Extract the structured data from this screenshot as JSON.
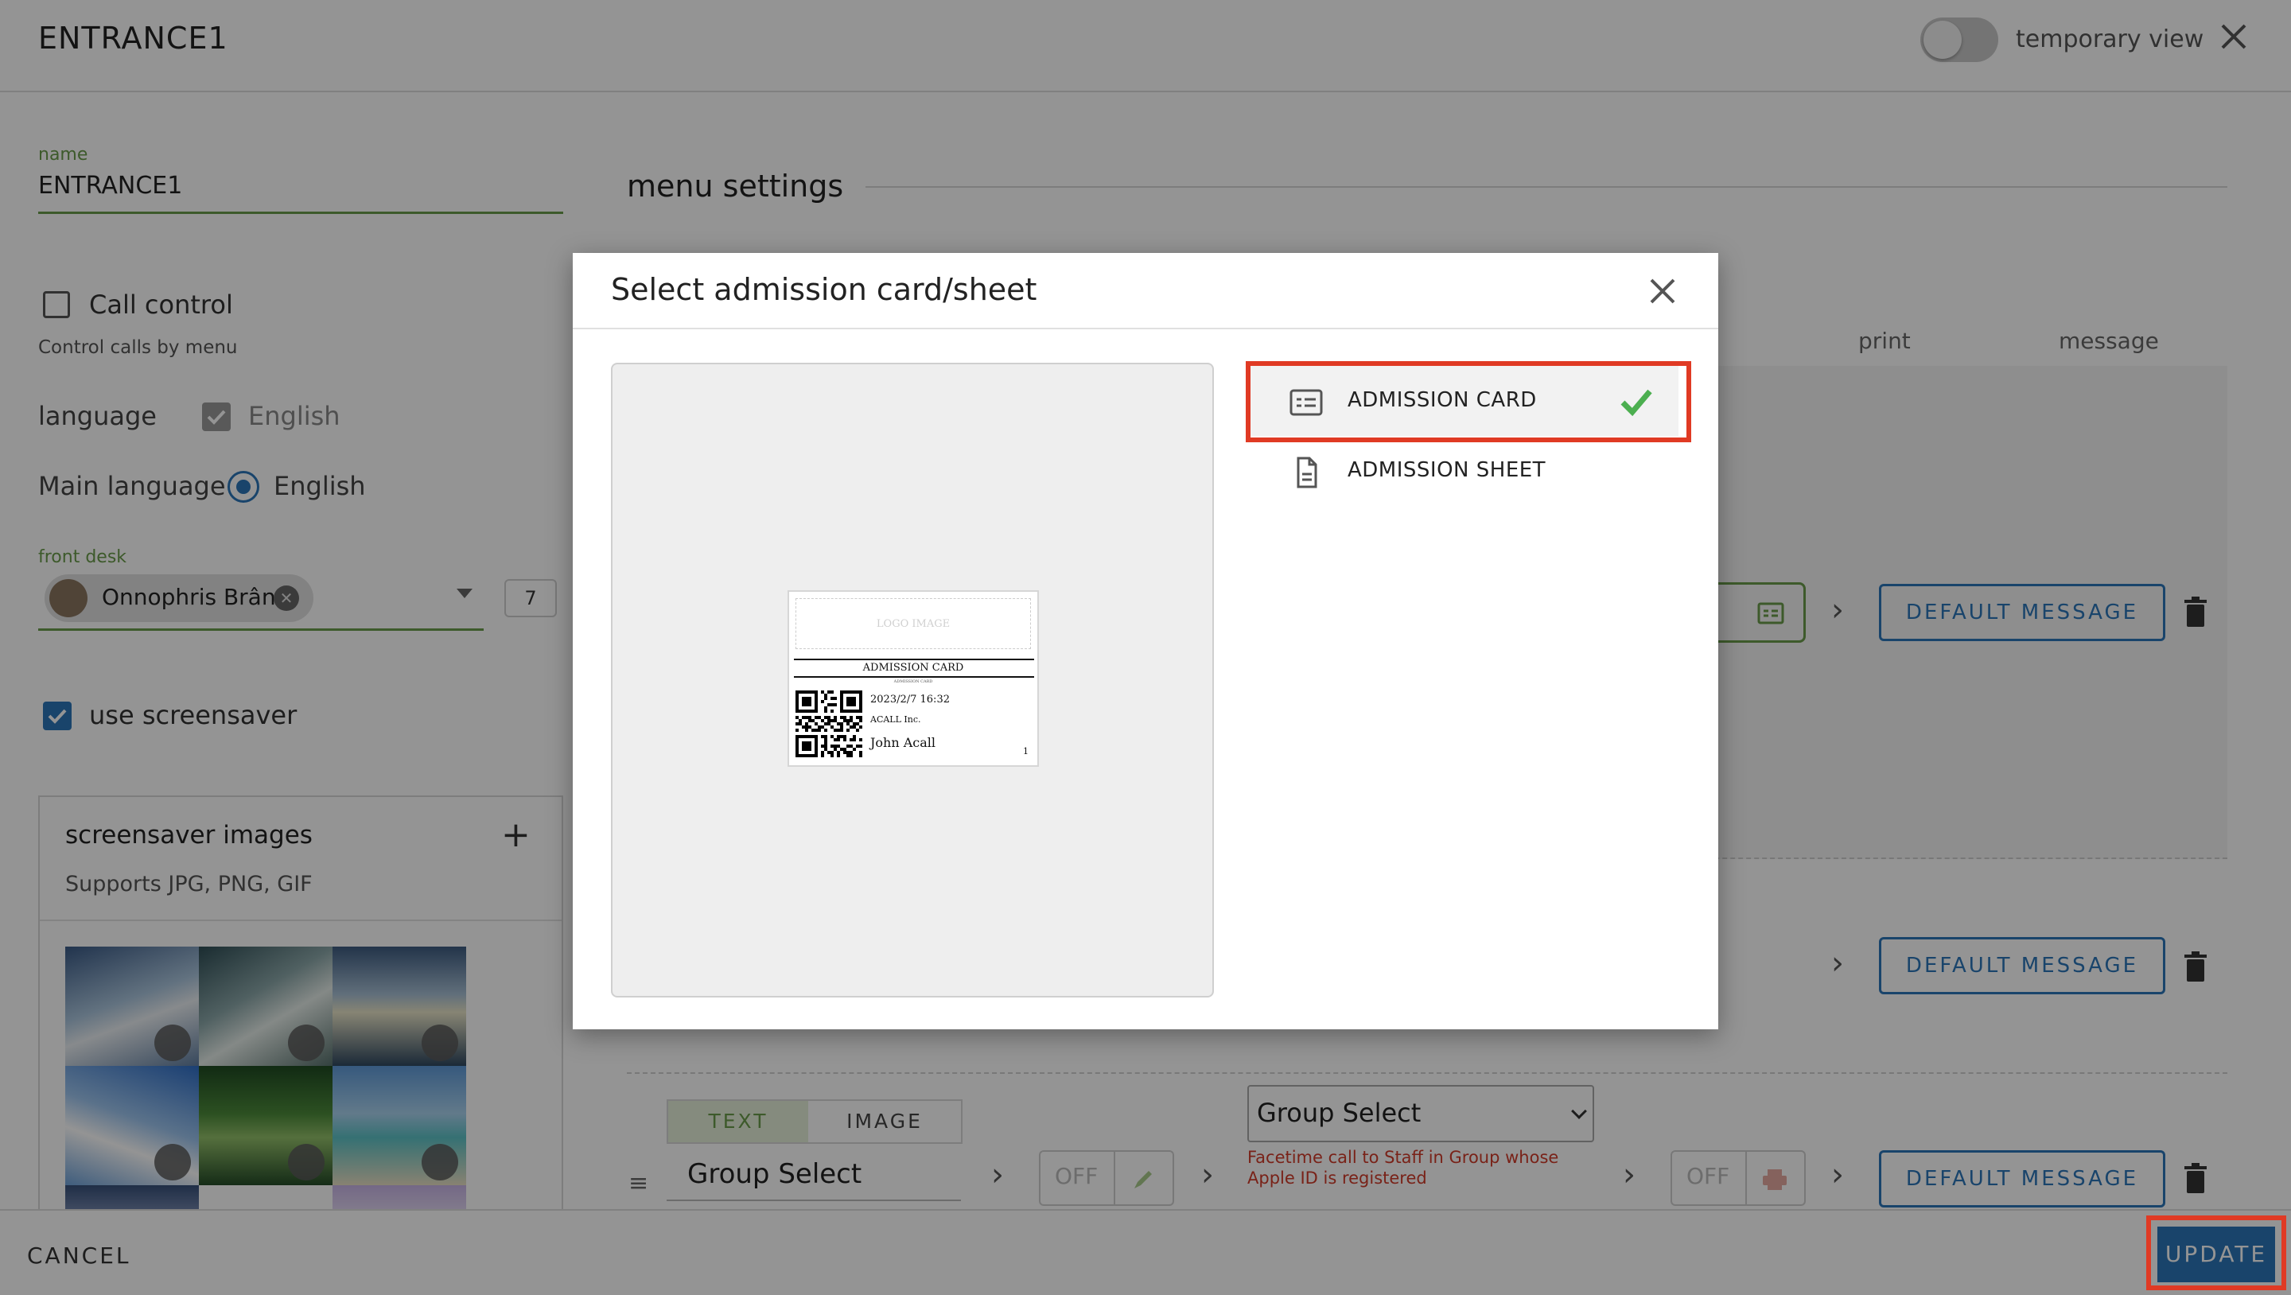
{
  "header": {
    "title": "ENTRANCE1",
    "temporary_view_label": "temporary view"
  },
  "form": {
    "name_label": "name",
    "name_value": "ENTRANCE1",
    "call_control_label": "Call control",
    "call_control_sub": "Control calls by menu",
    "language_label": "language",
    "language_value": "English",
    "main_language_label": "Main language",
    "main_language_value": "English",
    "front_desk_label": "front desk",
    "front_desk_person": "Onnophris Brân",
    "front_desk_count": "7",
    "use_screensaver_label": "use screensaver"
  },
  "screensaver": {
    "title": "screensaver images",
    "subtitle": "Supports JPG, PNG, GIF"
  },
  "menu": {
    "title": "menu settings",
    "col_print": "print",
    "col_message": "message",
    "default_message_label": "DEFAULT MESSAGE",
    "off_label": "OFF",
    "tab_text": "TEXT",
    "tab_image": "IMAGE",
    "group_select_input": "Group Select",
    "group_select_option": "Group Select",
    "group_select_hint": "Facetime call to Staff in Group whose Apple ID is registered"
  },
  "footer": {
    "cancel_label": "CANCEL",
    "update_label": "UPDATE"
  },
  "dialog": {
    "title": "Select admission card/sheet",
    "options": [
      {
        "label": "ADMISSION CARD",
        "icon": "card-icon",
        "selected": true
      },
      {
        "label": "ADMISSION SHEET",
        "icon": "document-icon",
        "selected": false
      }
    ],
    "preview": {
      "logo_text": "LOGO IMAGE",
      "card_title": "ADMISSION CARD",
      "card_subtitle": "ADMISSION CARD",
      "date": "2023/2/7 16:32",
      "company": "ACALL Inc.",
      "name": "John Acall",
      "number": "1"
    }
  },
  "colors": {
    "accent_blue": "#2b76b9",
    "accent_green": "#6a9b4a",
    "highlight_red": "#e03a24",
    "check_green": "#4caf50"
  }
}
